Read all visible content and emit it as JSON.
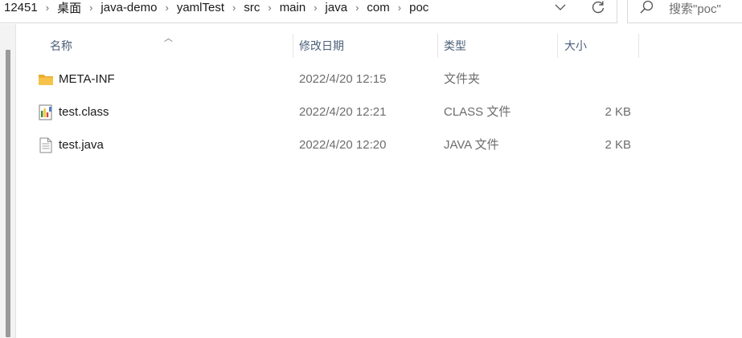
{
  "breadcrumb": [
    "12451",
    "桌面",
    "java-demo",
    "yamlTest",
    "src",
    "main",
    "java",
    "com",
    "poc"
  ],
  "search": {
    "placeholder": "搜索\"poc\""
  },
  "columns": {
    "name": "名称",
    "date": "修改日期",
    "type": "类型",
    "size": "大小"
  },
  "files": [
    {
      "name": "META-INF",
      "date": "2022/4/20 12:15",
      "type": "文件夹",
      "size": "",
      "icon": "folder-icon"
    },
    {
      "name": "test.class",
      "date": "2022/4/20 12:21",
      "type": "CLASS 文件",
      "size": "2 KB",
      "icon": "class-file-icon"
    },
    {
      "name": "test.java",
      "date": "2022/4/20 12:20",
      "type": "JAVA 文件",
      "size": "2 KB",
      "icon": "text-file-icon"
    }
  ],
  "colors": {
    "header_text": "#4c607a",
    "folder": "#f6c24a",
    "muted_text": "#6d6d6d"
  }
}
